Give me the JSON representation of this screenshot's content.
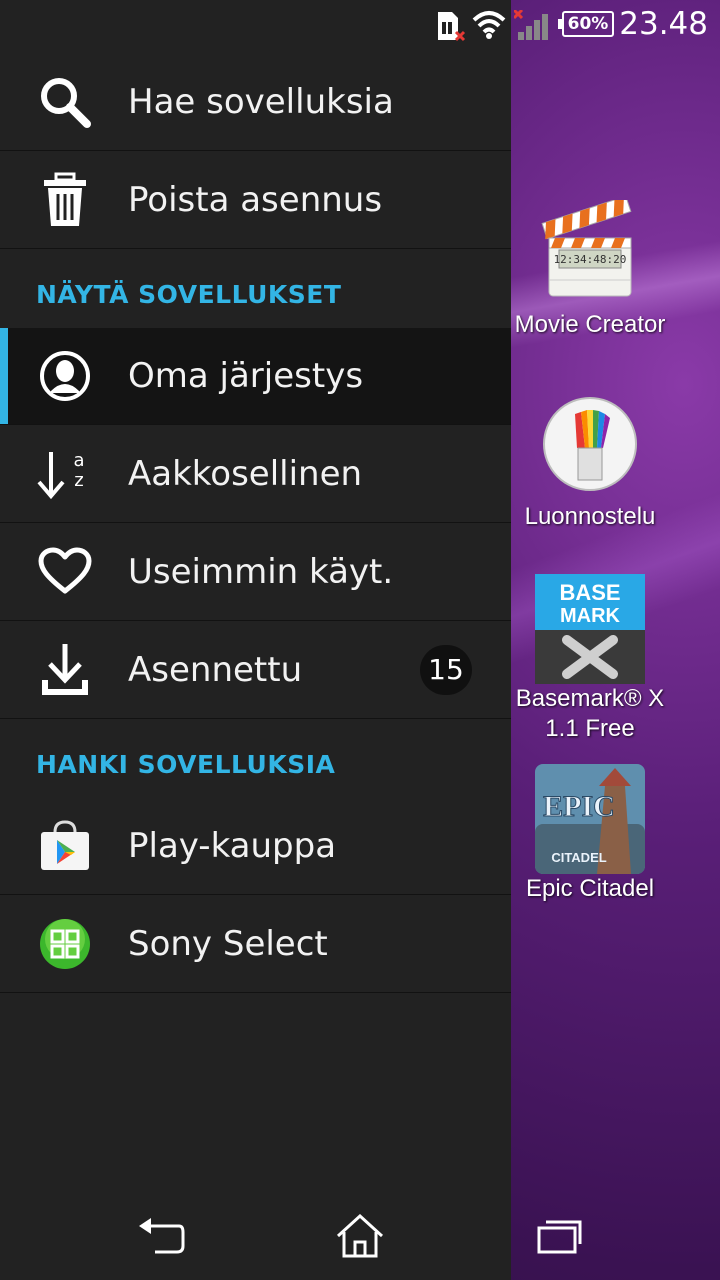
{
  "status_bar": {
    "time": "23.48",
    "battery": "60%"
  },
  "drawer": {
    "search_label": "Hae sovelluksia",
    "uninstall_label": "Poista asennus",
    "show_apps_header": "NÄYTÄ SOVELLUKSET",
    "sort_items": [
      {
        "label": "Oma järjestys",
        "icon": "person-icon",
        "selected": true
      },
      {
        "label": "Aakkosellinen",
        "icon": "sort-alpha-icon"
      },
      {
        "label": "Useimmin käyt.",
        "icon": "heart-icon"
      },
      {
        "label": "Asennettu",
        "icon": "download-icon",
        "badge": "15"
      }
    ],
    "get_apps_header": "HANKI SOVELLUKSIA",
    "store_items": [
      {
        "label": "Play-kauppa",
        "icon": "play-store-icon"
      },
      {
        "label": "Sony Select",
        "icon": "sony-select-icon"
      }
    ]
  },
  "home_apps": [
    {
      "label": "Movie Creator",
      "icon": "clapperboard-icon"
    },
    {
      "label": "Luonnostelu",
      "icon": "paintbrush-icon"
    },
    {
      "label_line1": "Basemark® X",
      "label_line2": "1.1 Free",
      "icon_text1": "BASE",
      "icon_text2": "MARK",
      "icon": "basemark-icon"
    },
    {
      "label": "Epic Citadel",
      "icon_text1": "EPIC",
      "icon_text2": "CITADEL",
      "icon": "epic-citadel-icon"
    }
  ],
  "colors": {
    "accent": "#33b5e5",
    "drawer_bg": "#222222"
  }
}
